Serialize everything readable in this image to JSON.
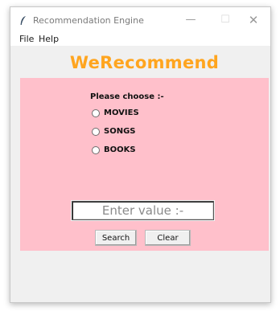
{
  "window": {
    "title": "Recommendation Engine"
  },
  "menu": {
    "file": "File",
    "help": "Help"
  },
  "app": {
    "title": "WeRecommend"
  },
  "panel": {
    "prompt": "Please choose :-",
    "options": [
      "MOVIES",
      "SONGS",
      "BOOKS"
    ],
    "entry_placeholder": "Enter value :-"
  },
  "buttons": {
    "search": "Search",
    "clear": "Clear"
  }
}
